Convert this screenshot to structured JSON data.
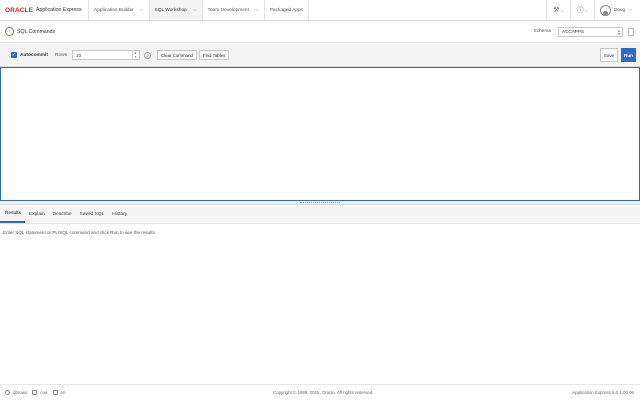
{
  "brand": {
    "oracle": "ORACLE",
    "product": "Application Express"
  },
  "nav": {
    "tabs": [
      {
        "label": "Application Builder"
      },
      {
        "label": "SQL Workshop"
      },
      {
        "label": "Team Development"
      },
      {
        "label": "Packaged Apps"
      }
    ],
    "active_tab": "SQL Workshop",
    "user": "Doug"
  },
  "page": {
    "title": "SQL Commands"
  },
  "schema": {
    "label": "Schema",
    "value": "ACCAPPS"
  },
  "toolbar": {
    "autocommit_label": "Autocommit",
    "autocommit_checked": true,
    "rows_label": "Rows",
    "rows_value": "10",
    "clear_label": "Clear Command",
    "find_label": "Find Tables",
    "save_label": "Save",
    "run_label": "Run"
  },
  "editor": {
    "content": ""
  },
  "results": {
    "tabs": [
      "Results",
      "Explain",
      "Describe",
      "Saved SQL",
      "History"
    ],
    "active_tab": "Results",
    "message": "Enter SQL statement or PL/SQL command and click Run to see the results."
  },
  "footer": {
    "items": [
      "dbrown",
      "coa",
      "en"
    ],
    "copyright": "Copyright © 1999, 2015, Oracle. All rights reserved.",
    "version": "Application Express 5.0.1.00.06"
  },
  "colors": {
    "accent": "#2e6bc6",
    "brand_red": "#e0201b",
    "success": "#4a9c3c"
  }
}
